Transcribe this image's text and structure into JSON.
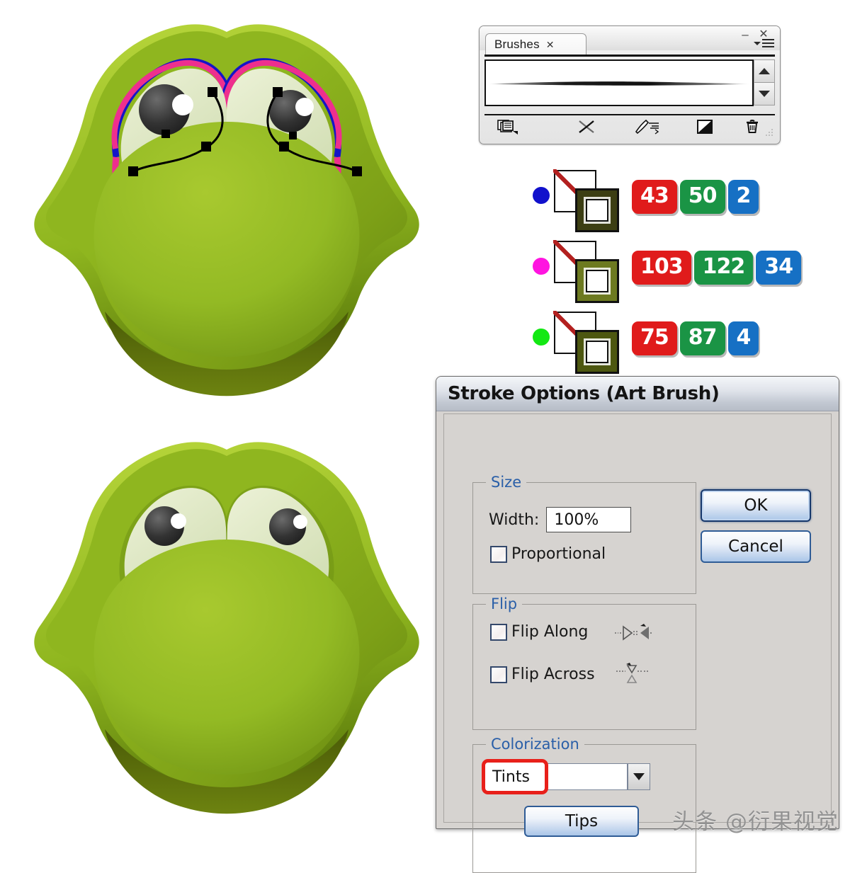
{
  "illustrations": {
    "top": {
      "name": "frog-face-with-selected-path",
      "caption_none": "",
      "eye_outline_colors": [
        "#1515c8",
        "#ee2f8e"
      ],
      "body_green_light": "#9cc02a",
      "body_green_dark": "#6f8e12",
      "eye_white": "#dfe8c4"
    },
    "bottom": {
      "name": "frog-face-final",
      "body_green_light": "#9cc02a",
      "body_green_dark": "#6f8e12",
      "eye_white": "#dfe8c4"
    }
  },
  "brushes_panel": {
    "tab_label": "Brushes",
    "tab_close_glyph": "✕",
    "minimize_glyph": "–",
    "close_glyph": "✕",
    "menu_icon": "panel-menu-icon",
    "scroll_up_icon": "chevron-up-icon",
    "scroll_down_icon": "chevron-down-icon",
    "brush_item": "tapered-art-brush-stroke",
    "toolbar": [
      {
        "name": "brush-libraries-menu-icon",
        "label": ""
      },
      {
        "name": "remove-brush-stroke-icon",
        "label": ""
      },
      {
        "name": "options-of-selected-object-icon",
        "label": ""
      },
      {
        "name": "new-brush-icon",
        "label": ""
      },
      {
        "name": "delete-brush-icon",
        "label": ""
      }
    ]
  },
  "swatch_rows": [
    {
      "dot_color": "#1111cc",
      "dot_name": "blue-path-marker",
      "stroke_label": "none",
      "fill_color": "#3c3e13",
      "rgb": {
        "r": "43",
        "g": "50",
        "b": "2"
      }
    },
    {
      "dot_color": "#ff14e0",
      "dot_name": "magenta-path-marker",
      "stroke_label": "none",
      "fill_color": "#6d7a20",
      "rgb": {
        "r": "103",
        "g": "122",
        "b": "34"
      }
    },
    {
      "dot_color": "#13e813",
      "dot_name": "green-path-marker",
      "stroke_label": "none",
      "fill_color": "#4d5710",
      "rgb": {
        "r": "75",
        "g": "87",
        "b": "4"
      }
    }
  ],
  "stroke_dialog": {
    "title": "Stroke Options (Art Brush)",
    "size": {
      "legend": "Size",
      "width_label": "Width:",
      "width_value": "100%",
      "proportional_label": "Proportional",
      "proportional_checked": false
    },
    "flip": {
      "legend": "Flip",
      "flip_along_label": "Flip Along",
      "flip_along_checked": false,
      "flip_across_label": "Flip Across",
      "flip_across_checked": false
    },
    "colorization": {
      "legend": "Colorization",
      "method_value": "Tints",
      "method_placeholder": "",
      "tips_label": "Tips",
      "highlight_color": "#e8201a"
    },
    "buttons": {
      "ok_label": "OK",
      "cancel_label": "Cancel"
    }
  },
  "watermark": {
    "text": "头条 @衍果视觉"
  }
}
